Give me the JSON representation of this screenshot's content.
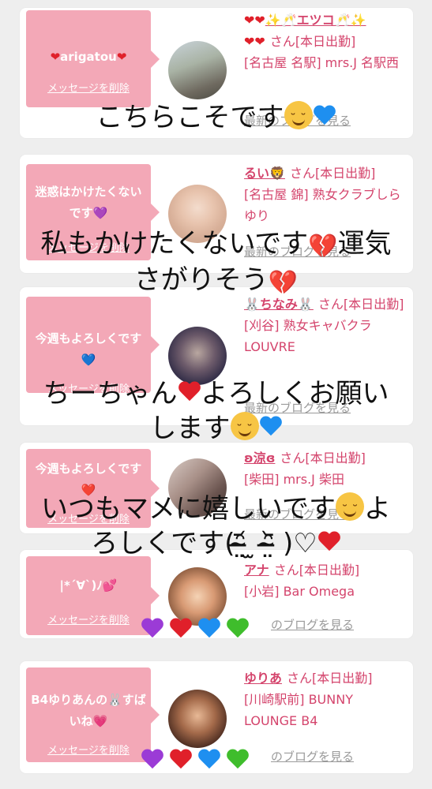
{
  "cards": [
    {
      "message": "arigatou",
      "delete_label": "メッセージを削除",
      "name": "✨🥂エツコ🥂✨",
      "suffix": "さん[本日出勤]",
      "store": "[名古屋 名駅] mrs.J 名駅西",
      "blog_label": "最新のブログを見る"
    },
    {
      "message": "迷惑はかけたくないです💜",
      "delete_label": "メッセージを削除",
      "name": "るい🦁",
      "suffix": "さん[本日出勤]",
      "store": "[名古屋 錦] 熟女クラブしらゆり",
      "blog_label": "最新のブログを見る"
    },
    {
      "message": "今週もよろしくです💙",
      "delete_label": "メッセージを削除",
      "name": "🐰ちなみ🐰",
      "suffix": "さん[本日出勤]",
      "store": "[刈谷] 熟女キャバクラLOUVRE",
      "blog_label": "最新のブログを見る"
    },
    {
      "message": "今週もよろしくです❤️",
      "delete_label": "メッセージを削除",
      "name": "ʚ涼ɞ",
      "suffix": "さん[本日出勤]",
      "store": "[柴田] mrs.J 柴田",
      "blog_label": "最新のブログを見る"
    },
    {
      "message": "|*´∀`)ﾉ💕",
      "delete_label": "メッセージを削除",
      "name": "アナ",
      "suffix": "さん[本日出勤]",
      "store": "[小岩] Bar Omega",
      "blog_label": "のブログを見る"
    },
    {
      "message": "B4ゆりあんの🐰すばいね💗",
      "delete_label": "メッセージを削除",
      "name": "ゆりあ",
      "suffix": "さん[本日出勤]",
      "store": "[川崎駅前] BUNNY LOUNGE B4",
      "blog_label": "のブログを見る"
    }
  ],
  "captions": {
    "c1": "こちらこそです",
    "c2a": "私もかけたくないです",
    "c2b": "運気",
    "c2c": "さがりそう",
    "c3a": "ちーちゃん",
    "c3b": "よろしくお願い",
    "c3c": "します",
    "c4a": "いつもマメに嬉しいです",
    "c4b": "よ",
    "c4c": "ろしくです(ᵔ̴̶̤᷄ ̫ ᵔ̴̶̤᷅ )♡"
  },
  "colors": {
    "accent": "#d4446c",
    "bubble": "#f3a8b7",
    "heart_red": "#e0202a",
    "heart_blue": "#1e8ff0",
    "heart_purple": "#9b3bd6",
    "heart_green": "#3fbd2c"
  },
  "icons": {
    "heart": "heart-icon",
    "smiley": "smiling-face-icon",
    "broken_heart": "broken-heart-icon"
  }
}
